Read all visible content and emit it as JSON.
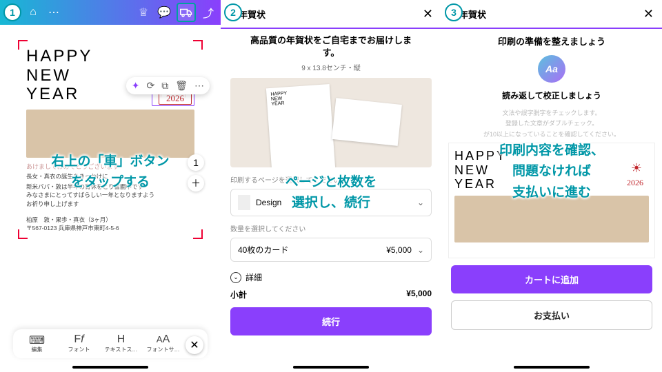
{
  "screen1": {
    "badge": "1",
    "card": {
      "line1": "HAPPY",
      "line2": "NEW",
      "line3": "YEAR",
      "year": "2026"
    },
    "greeting": "あけましておめでとうございます",
    "sub": "長女・真衣の誕生をきっかけに",
    "body_l1": "新米パパ・敦は半年の育休をとり奮闘中です",
    "body_l2": "みなさまにとってすばらしい一年となりますよう",
    "body_l3": "お祈り申し上げます",
    "sig1": "柏原　敦・果歩・真衣（3ヶ月）",
    "sig2": "〒567-0123 兵庫県神戸市東町4-5-6",
    "toolbar": {
      "t1": "編集",
      "t2": "フォント",
      "t3": "テキストス…",
      "t4": "フォントサ…"
    },
    "overlay_l1": "右上の「車」ボタン",
    "overlay_l2": "をタップする"
  },
  "screen2": {
    "badge": "2",
    "header": "年賀状",
    "lead_l1": "高品質の年賀状をご自宅までお届けしま",
    "lead_l2": "す。",
    "dim": "9 x 13.8センチ・縦",
    "sec1": "印刷するページを選択してください",
    "design": "Design",
    "sec2": "数量を選択してください",
    "qty": "40枚のカード",
    "price": "¥5,000",
    "detail": "詳細",
    "subtotal_lbl": "小計",
    "subtotal": "¥5,000",
    "continue": "続行",
    "overlay_l1": "ページと枚数を",
    "overlay_l2": "選択し、続行"
  },
  "screen3": {
    "badge": "3",
    "header": "年賀状",
    "lead": "印刷の準備を整えましょう",
    "aa": "Aa",
    "t1": "読み返して校正しましょう",
    "t2_l1": "文法や誤字脱字をチェックします。",
    "t2_l2": "登録した文章がダブルチェック。",
    "t2_l3": "が10以上になっていることを確認してください。",
    "overlay_l1": "印刷内容を確認、",
    "overlay_l2": "問題なければ",
    "overlay_l3": "支払いに進む",
    "card": {
      "line1": "HAPPY",
      "line2": "NEW",
      "line3": "YEAR",
      "year": "2026"
    },
    "btn1": "カートに追加",
    "btn2": "お支払い"
  }
}
